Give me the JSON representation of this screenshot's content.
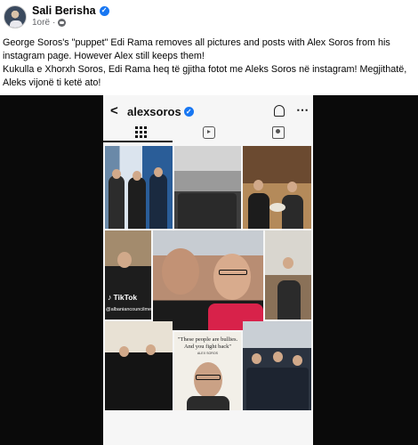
{
  "post": {
    "author": "Sali Berisha",
    "time": "1orë",
    "text_en": "George Soros's \"puppet\" Edi Rama removes all pictures and posts with Alex Soros from his instagram page. However Alex still keeps them!",
    "text_sq": "Kukulla e Xhorxh Soros, Edi Rama heq të gjitha fotot me Aleks Soros në instagram! Megjithatë, Aleks vijonë ti ketë ato!"
  },
  "instagram": {
    "username": "alexsoros",
    "tiktok_label": "TikTok",
    "tiktok_handle": "@albaniancouncilmedia",
    "quote_text": "\"These people are bullies. And you fight back\"",
    "quote_name": "ALEX SOROS"
  },
  "colors": {
    "facebook_blue": "#1877f2",
    "media_background": "#0a0a0a",
    "text_primary": "#050505",
    "text_secondary": "#65676b"
  },
  "icons": [
    "verified-icon",
    "globe-icon",
    "back-icon",
    "bell-icon",
    "more-icon",
    "grid-icon",
    "reels-icon",
    "tagged-icon",
    "tiktok-icon"
  ]
}
